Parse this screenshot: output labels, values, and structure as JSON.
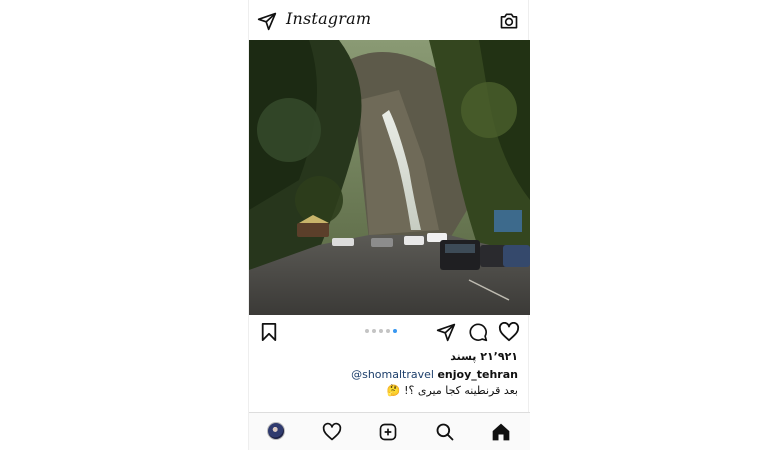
{
  "app": {
    "name": "Instagram"
  },
  "icons": {
    "direct": "paper-plane-icon",
    "camera": "camera-icon",
    "bookmark": "bookmark-icon",
    "share": "paper-plane-icon",
    "comment": "comment-bubble-icon",
    "like": "heart-icon",
    "home": "home-icon",
    "search": "search-icon",
    "add": "add-post-icon",
    "activity": "heart-icon"
  },
  "colors": {
    "active_dot": "#3897f0",
    "inactive_dot": "#c4c4c4",
    "mention": "#1d3f6b",
    "text": "#111111"
  },
  "post": {
    "carousel": {
      "total": 5,
      "active_index": 4
    },
    "likes_label": "۲۱٬۹۲۱ پسند",
    "caption": {
      "mention": "@shomaltravel",
      "username": "enjoy_tehran",
      "text": "بعد قرنطینه کجا میری ؟! 🤔"
    }
  }
}
